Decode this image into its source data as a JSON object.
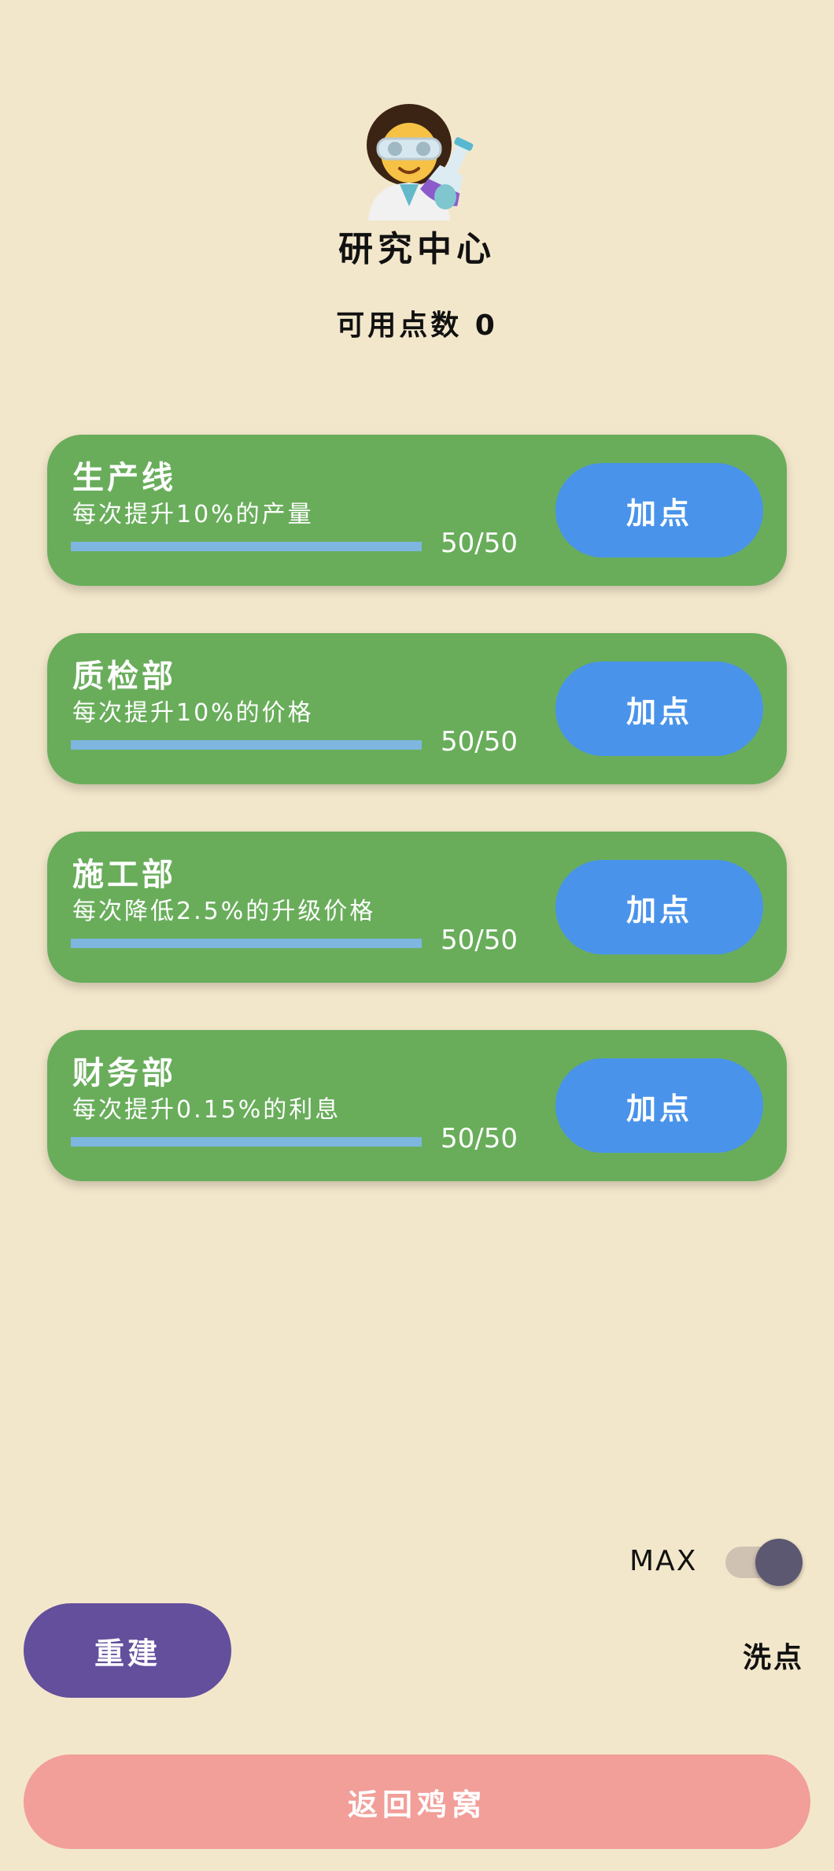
{
  "header": {
    "icon": "scientist-emoji",
    "title": "研究中心",
    "points_text": "可用点数 0"
  },
  "cards": [
    {
      "title": "生产线",
      "desc": "每次提升10%的产量",
      "progress_text": "50/50",
      "progress_fraction": 1.0,
      "button_label": "加点"
    },
    {
      "title": "质检部",
      "desc": "每次提升10%的价格",
      "progress_text": "50/50",
      "progress_fraction": 1.0,
      "button_label": "加点"
    },
    {
      "title": "施工部",
      "desc": "每次降低2.5%的升级价格",
      "progress_text": "50/50",
      "progress_fraction": 1.0,
      "button_label": "加点"
    },
    {
      "title": "财务部",
      "desc": "每次提升0.15%的利息",
      "progress_text": "50/50",
      "progress_fraction": 1.0,
      "button_label": "加点"
    }
  ],
  "controls": {
    "max_label": "MAX",
    "max_enabled": true,
    "rebuild_label": "重建",
    "reset_label": "洗点",
    "return_label": "返回鸡窝"
  },
  "colors": {
    "background": "#f3e7cb",
    "card": "#69ad5b",
    "card_button": "#4993ea",
    "rebuild_button": "#634f9c",
    "return_button": "#f29e99",
    "toggle_knob": "#5c5871"
  }
}
